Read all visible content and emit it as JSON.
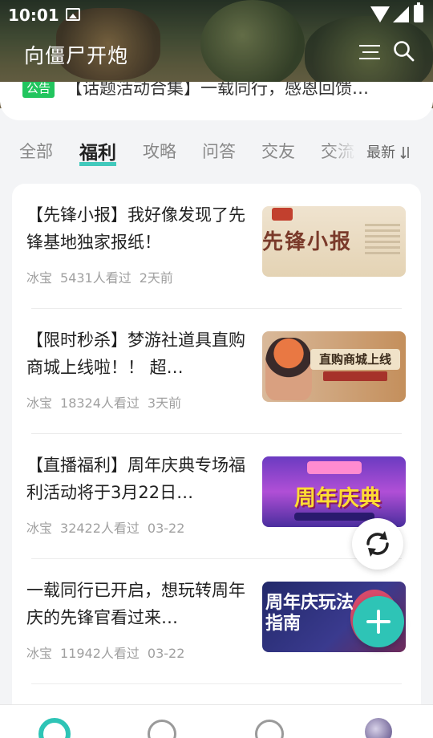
{
  "status_bar": {
    "time": "10:01"
  },
  "header": {
    "title": "向僵尸开炮"
  },
  "announcement": {
    "tag": "公告",
    "text": "【话题活动合集】一载同行，感恩回馈…"
  },
  "tabs": [
    {
      "label": "全部",
      "active": false
    },
    {
      "label": "福利",
      "active": true
    },
    {
      "label": "攻略",
      "active": false
    },
    {
      "label": "问答",
      "active": false
    },
    {
      "label": "交友",
      "active": false
    },
    {
      "label": "交流",
      "active": false
    }
  ],
  "sort": {
    "label": "最新",
    "icon": "sort-icon"
  },
  "posts": [
    {
      "title": "【先锋小报】我好像发现了先锋基地独家报纸！",
      "author": "冰宝",
      "views": "5431人看过",
      "time": "2天前",
      "thumb_text": "先锋小报"
    },
    {
      "title": "【限时秒杀】梦游社道具直购商城上线啦！！ 超…",
      "author": "冰宝",
      "views": "18324人看过",
      "time": "3天前",
      "thumb_text": "直购商城上线"
    },
    {
      "title": "【直播福利】周年庆典专场福利活动将于3月22日…",
      "author": "冰宝",
      "views": "32422人看过",
      "time": "03-22",
      "thumb_text": "周年庆典"
    },
    {
      "title": "一载同行已开启，想玩转周年庆的先锋官看过来…",
      "author": "冰宝",
      "views": "11942人看过",
      "time": "03-22",
      "thumb_text": "周年庆玩法指南"
    }
  ],
  "colors": {
    "accent": "#2ec4b6",
    "tag_green": "#22c55e"
  },
  "bottom_nav": [
    "home-icon",
    "explore-icon",
    "list-icon",
    "avatar"
  ]
}
